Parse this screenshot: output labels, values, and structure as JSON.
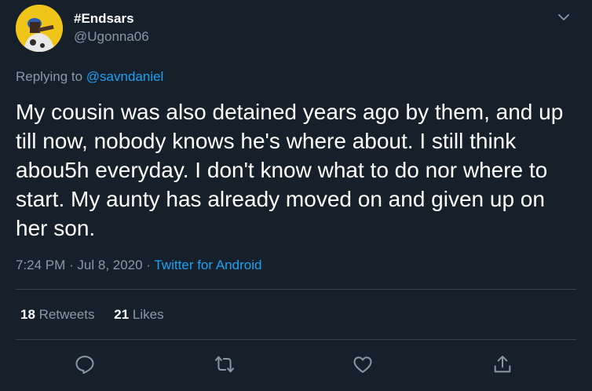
{
  "user": {
    "display_name": "#Endsars",
    "handle": "@Ugonna06"
  },
  "reply": {
    "prefix": "Replying to",
    "mention": "@savndaniel"
  },
  "tweet": {
    "text": "My cousin was also detained years ago by them, and up till now, nobody knows he's where about. I still think abou5h everyday. I don't know what to do nor where to start. My aunty has already moved on and given up on her son.",
    "time": "7:24 PM",
    "sep1": " · ",
    "date": "Jul 8, 2020",
    "sep2": " · ",
    "source": "Twitter for Android"
  },
  "stats": {
    "retweets_count": "18",
    "retweets_label": "Retweets",
    "likes_count": "21",
    "likes_label": "Likes"
  },
  "icons": {
    "caret": "chevron-down-icon",
    "reply": "reply-icon",
    "retweet": "retweet-icon",
    "like": "heart-icon",
    "share": "share-icon"
  },
  "colors": {
    "background": "#15202b",
    "text": "#ffffff",
    "secondary": "#8899a6",
    "accent": "#1da1f2",
    "divider": "#38444d",
    "avatar_bg": "#f0c51a"
  }
}
